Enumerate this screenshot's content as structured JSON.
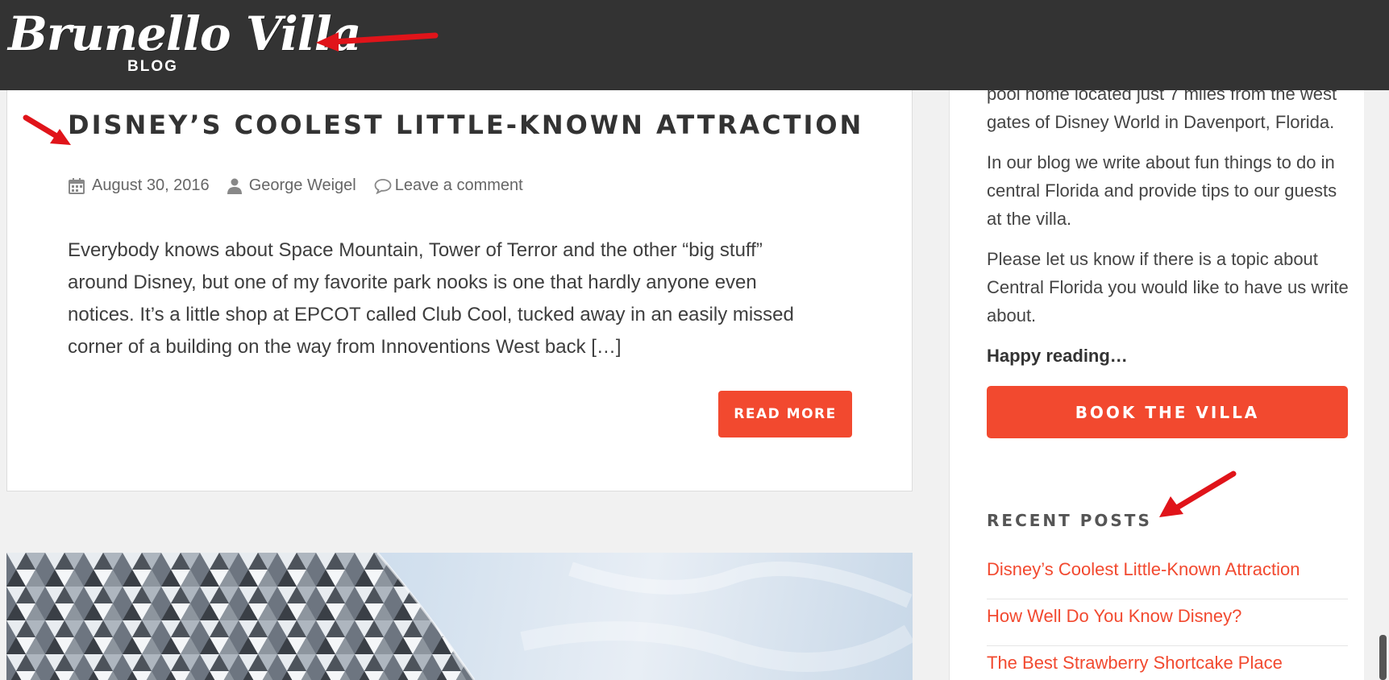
{
  "header": {
    "logo_script": "Brunello Villa",
    "logo_sub": "BLOG"
  },
  "post": {
    "title": "DISNEY’S COOLEST LITTLE-KNOWN ATTRACTION",
    "date": "August 30, 2016",
    "author": "George Weigel",
    "comment_link": "Leave a comment",
    "excerpt": "Everybody knows about Space Mountain, Tower of Terror and the other “big stuff” around Disney, but one of my favorite park nooks is one that hardly anyone even notices. It’s a little shop at EPCOT called Club Cool, tucked away in an easily missed corner of a building on the way from Innoventions West back […]",
    "read_more": "READ MORE",
    "meta_icons": [
      "calendar-icon",
      "user-icon",
      "comment-icon"
    ]
  },
  "sidebar": {
    "about_p1": "pool home located just 7 miles from the west gates of Disney World in Davenport, Florida.",
    "about_p2": "In our blog we write about fun things to do in central Florida and provide tips to our guests at the villa.",
    "about_p3": "Please let us know if there is a topic about Central Florida you would like to have us write about.",
    "happy": "Happy reading…",
    "book_button": "BOOK THE VILLA",
    "recent_heading": "RECENT POSTS",
    "recent_posts": [
      "Disney’s Coolest Little-Known Attraction",
      "How Well Do You Know Disney?",
      "The Best Strawberry Shortcake Place"
    ]
  },
  "colors": {
    "accent": "#f2492f",
    "header_bg": "#333333",
    "page_bg": "#f1f1f1",
    "annotation": "#e0141a"
  }
}
